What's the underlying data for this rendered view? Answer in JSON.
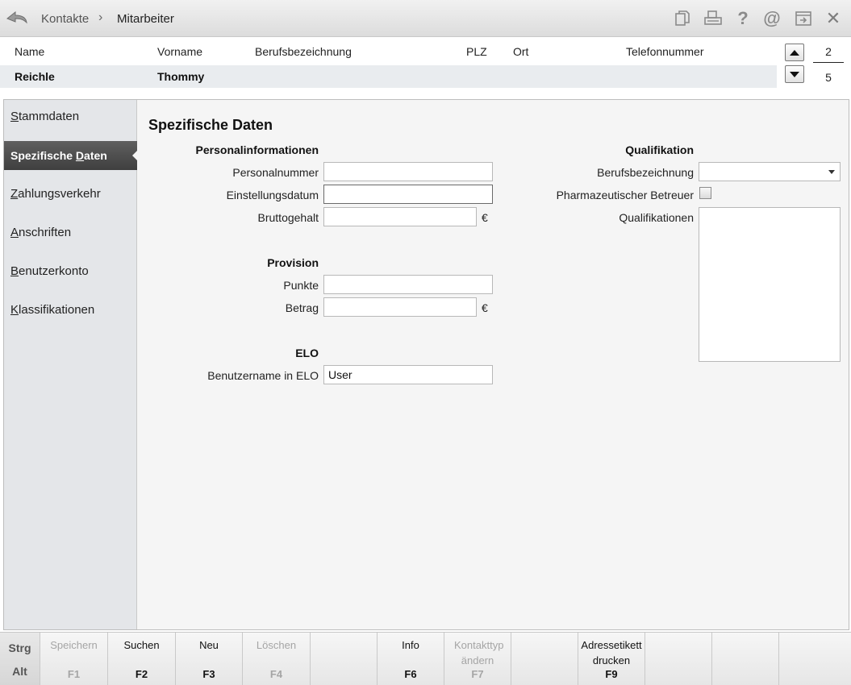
{
  "breadcrumb": {
    "parent": "Kontakte",
    "separator": "›",
    "current": "Mitarbeiter"
  },
  "toolbar_icons": [
    "copy-icon",
    "print-icon",
    "help-icon",
    "email-icon",
    "export-icon",
    "close-icon"
  ],
  "toolbar_text": {
    "help": "?",
    "email": "@",
    "close": "✕"
  },
  "list": {
    "columns": [
      "Name",
      "Vorname",
      "Berufsbezeichnung",
      "PLZ",
      "Ort",
      "Telefonnummer"
    ],
    "row": {
      "name": "Reichle",
      "vorname": "Thommy"
    },
    "current_index": "2",
    "total": "5"
  },
  "sidebar": {
    "items": [
      {
        "label": "Stammdaten",
        "accel": "S"
      },
      {
        "label": "Spezifische Daten",
        "accel": "D"
      },
      {
        "label": "Zahlungsverkehr",
        "accel": "Z"
      },
      {
        "label": "Anschriften",
        "accel": "A"
      },
      {
        "label": "Benutzerkonto",
        "accel": "B"
      },
      {
        "label": "Klassifikationen",
        "accel": "K"
      }
    ],
    "active_index": 1
  },
  "main": {
    "title": "Spezifische Daten",
    "personal": {
      "heading": "Personalinformationen",
      "personalnummer_label": "Personalnummer",
      "personalnummer_value": "",
      "einstellungsdatum_label": "Einstellungsdatum",
      "einstellungsdatum_value": "",
      "bruttogehalt_label": "Bruttogehalt",
      "bruttogehalt_value": "",
      "currency": "€"
    },
    "provision": {
      "heading": "Provision",
      "punkte_label": "Punkte",
      "punkte_value": "",
      "betrag_label": "Betrag",
      "betrag_value": "",
      "currency": "€"
    },
    "elo": {
      "heading": "ELO",
      "benutzername_label": "Benutzername in ELO",
      "benutzername_value": "User"
    },
    "qualifikation": {
      "heading": "Qualifikation",
      "berufsbezeichnung_label": "Berufsbezeichnung",
      "berufsbezeichnung_value": "",
      "pharma_label": "Pharmazeutischer Betreuer",
      "pharma_checked": false,
      "qualifikationen_label": "Qualifikationen"
    }
  },
  "fkeys": {
    "modifiers": {
      "ctrl": "Strg",
      "alt": "Alt"
    },
    "keys": [
      {
        "label": "Speichern",
        "key": "F1",
        "enabled": false
      },
      {
        "label": "Suchen",
        "key": "F2",
        "enabled": true
      },
      {
        "label": "Neu",
        "key": "F3",
        "enabled": true
      },
      {
        "label": "Löschen",
        "key": "F4",
        "enabled": false
      },
      {
        "label": "",
        "key": "",
        "enabled": false
      },
      {
        "label": "Info",
        "key": "F6",
        "enabled": true
      },
      {
        "label": "Kontakttyp ändern",
        "key": "F7",
        "enabled": false
      },
      {
        "label": "",
        "key": "",
        "enabled": false
      },
      {
        "label": "Adressetikett drucken",
        "key": "F9",
        "enabled": true
      },
      {
        "label": "",
        "key": "",
        "enabled": false
      },
      {
        "label": "",
        "key": "",
        "enabled": false
      },
      {
        "label": "",
        "key": "",
        "enabled": false
      }
    ]
  }
}
